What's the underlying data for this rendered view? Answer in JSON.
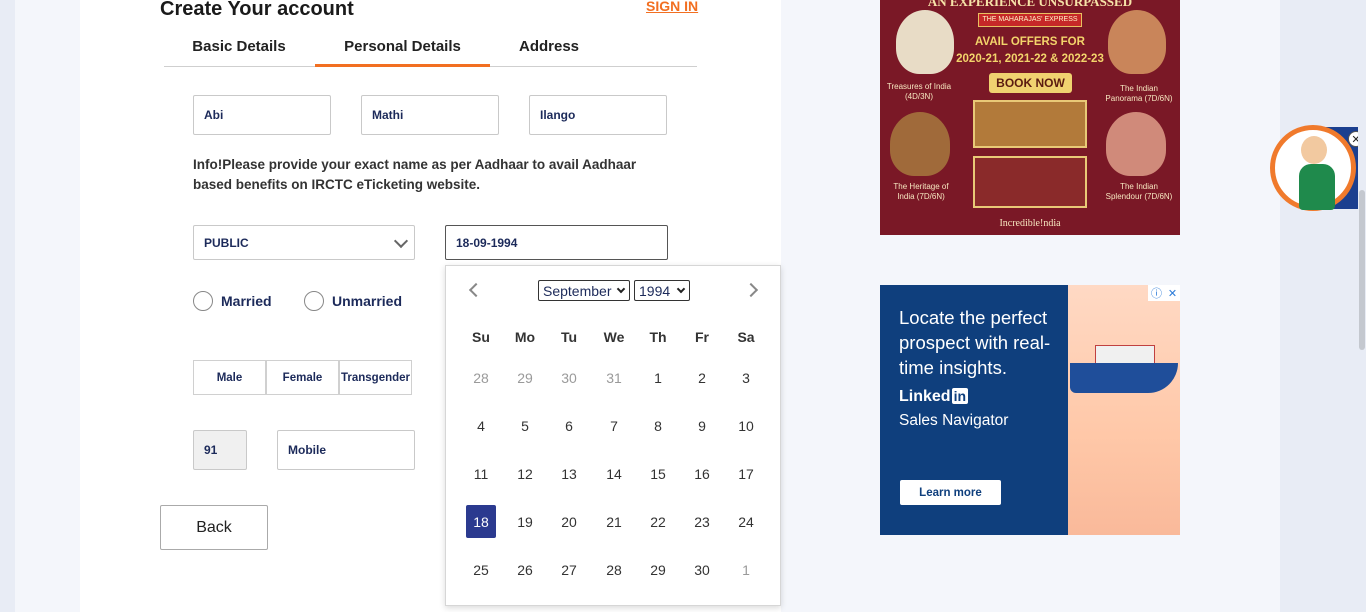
{
  "form": {
    "title": "Create Your account",
    "sign_in": "SIGN IN",
    "tabs": [
      "Basic Details",
      "Personal Details",
      "Address"
    ],
    "first_name": "Abi",
    "middle_name": "Mathi",
    "last_name": "Ilango",
    "info": "Info!Please provide your exact name as per Aadhaar to avail Aadhaar based benefits on IRCTC eTicketing website.",
    "occupation": "PUBLIC",
    "dob": "18-09-1994",
    "marital": [
      "Married",
      "Unmarried"
    ],
    "gender": [
      "Male",
      "Female",
      "Transgender"
    ],
    "country_code": "91",
    "mobile_placeholder": "Mobile",
    "back_label": "Back"
  },
  "calendar": {
    "month": "September",
    "year": "1994",
    "weekdays": [
      "Su",
      "Mo",
      "Tu",
      "We",
      "Th",
      "Fr",
      "Sa"
    ],
    "weeks": [
      [
        "28",
        "29",
        "30",
        "31",
        "1",
        "2",
        "3"
      ],
      [
        "4",
        "5",
        "6",
        "7",
        "8",
        "9",
        "10"
      ],
      [
        "11",
        "12",
        "13",
        "14",
        "15",
        "16",
        "17"
      ],
      [
        "18",
        "19",
        "20",
        "21",
        "22",
        "23",
        "24"
      ],
      [
        "25",
        "26",
        "27",
        "28",
        "29",
        "30",
        "1"
      ]
    ],
    "muted": [
      [
        0,
        0
      ],
      [
        0,
        1
      ],
      [
        0,
        2
      ],
      [
        0,
        3
      ],
      [
        4,
        6
      ]
    ],
    "selected": [
      3,
      0
    ]
  },
  "ads": {
    "maharaja": {
      "header": "AN EXPERIENCE UNSURPASSED",
      "badge": "THE MAHARAJAS' EXPRESS",
      "offer_line1": "AVAIL OFFERS FOR",
      "offer_line2": "2020-21, 2021-22 & 2022-23",
      "book_now": "BOOK NOW",
      "cap_tl": "Treasures of India (4D/3N)",
      "cap_tr": "The Indian Panorama (7D/6N)",
      "cap_bl": "The Heritage of India (7D/6N)",
      "cap_br": "The Indian Splendour (7D/6N)",
      "footer": "Incredible!ndia"
    },
    "linkedin": {
      "headline": "Locate the perfect prospect with real-time insights.",
      "brand": "Linked",
      "brand_in": "in",
      "product": "Sales Navigator",
      "cta": "Learn more",
      "adchoices_info": "ⓘ",
      "adchoices_close": "✕"
    }
  },
  "mascot": {
    "close": "✕"
  },
  "colors": {
    "accent": "#f26f21",
    "primary": "#2b3a8f",
    "text_dark": "#1c2a5a"
  }
}
